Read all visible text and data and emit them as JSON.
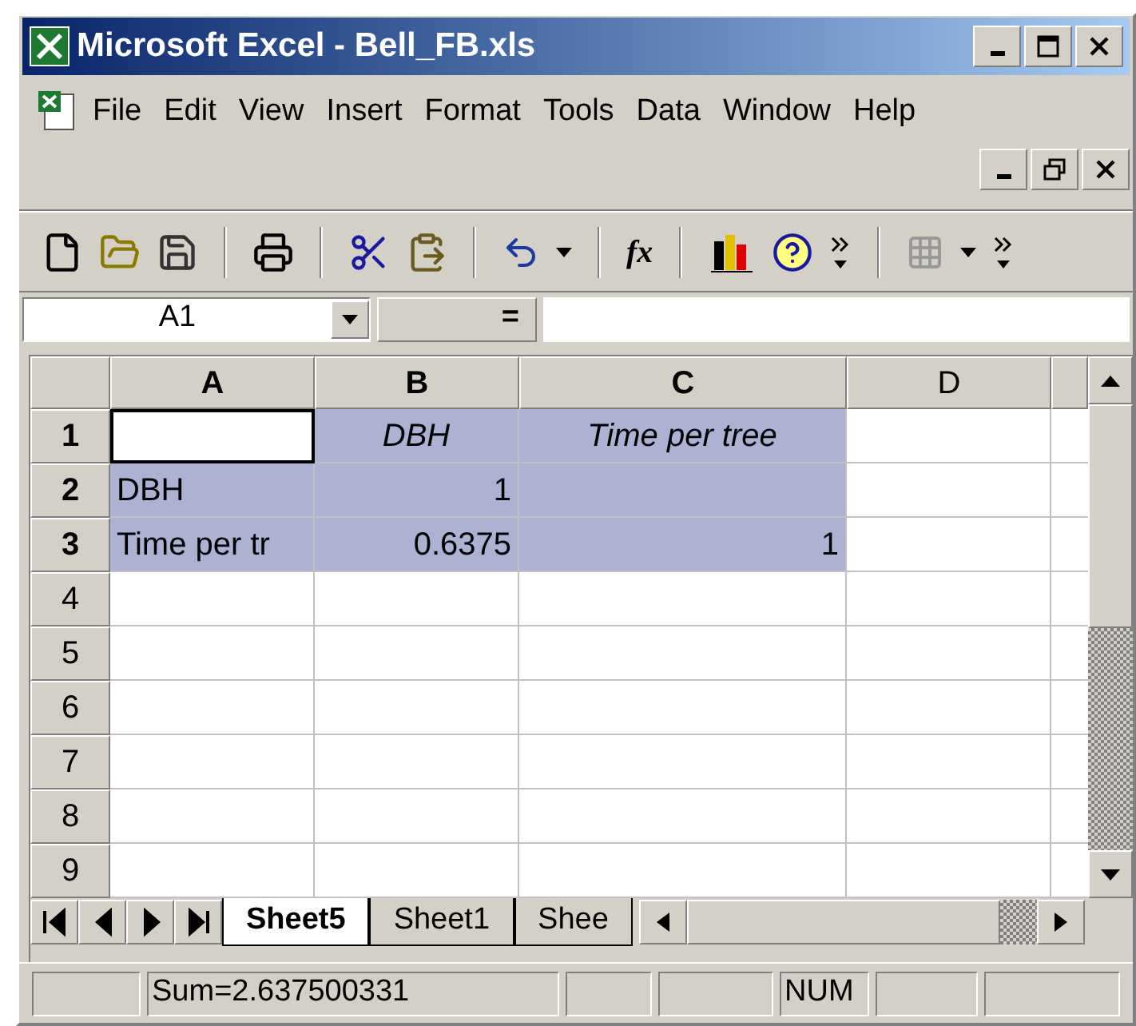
{
  "window": {
    "title": "Microsoft Excel - Bell_FB.xls"
  },
  "menu": [
    "File",
    "Edit",
    "View",
    "Insert",
    "Format",
    "Tools",
    "Data",
    "Window",
    "Help"
  ],
  "toolbar": {
    "function_button": "fx"
  },
  "formula_bar": {
    "name_box": "A1",
    "equals": "="
  },
  "columns": [
    {
      "label": "A",
      "selected": true
    },
    {
      "label": "B",
      "selected": true
    },
    {
      "label": "C",
      "selected": true
    },
    {
      "label": "D",
      "selected": false
    }
  ],
  "rows": [
    {
      "label": "1",
      "selected": true,
      "cells": [
        {
          "kind": "empty",
          "selected": true,
          "active": true
        },
        {
          "kind": "heading",
          "text": "DBH",
          "selected": true,
          "active": false
        },
        {
          "kind": "heading",
          "text": "Time per tree",
          "selected": true,
          "active": false
        },
        {
          "kind": "empty",
          "selected": false,
          "active": false
        }
      ]
    },
    {
      "label": "2",
      "selected": true,
      "cells": [
        {
          "kind": "label",
          "text": "DBH",
          "selected": true,
          "active": false
        },
        {
          "kind": "number",
          "text": "1",
          "selected": true,
          "active": false
        },
        {
          "kind": "empty",
          "selected": true,
          "active": false
        },
        {
          "kind": "empty",
          "selected": false,
          "active": false
        }
      ]
    },
    {
      "label": "3",
      "selected": true,
      "cells": [
        {
          "kind": "label",
          "text": "Time per tr",
          "selected": true,
          "active": false
        },
        {
          "kind": "number",
          "text": "0.6375",
          "selected": true,
          "active": false
        },
        {
          "kind": "number",
          "text": "1",
          "selected": true,
          "active": false
        },
        {
          "kind": "empty",
          "selected": false,
          "active": false
        }
      ]
    },
    {
      "label": "4",
      "selected": false,
      "cells": []
    },
    {
      "label": "5",
      "selected": false,
      "cells": []
    },
    {
      "label": "6",
      "selected": false,
      "cells": []
    },
    {
      "label": "7",
      "selected": false,
      "cells": []
    },
    {
      "label": "8",
      "selected": false,
      "cells": []
    },
    {
      "label": "9",
      "selected": false,
      "cells": []
    }
  ],
  "sheet_tabs": [
    {
      "label": "Sheet5",
      "selected": true
    },
    {
      "label": "Sheet1",
      "selected": false
    },
    {
      "label": "Shee",
      "selected": false
    }
  ],
  "status_bar": {
    "sum": "Sum=2.637500331",
    "num_lock": "NUM"
  }
}
